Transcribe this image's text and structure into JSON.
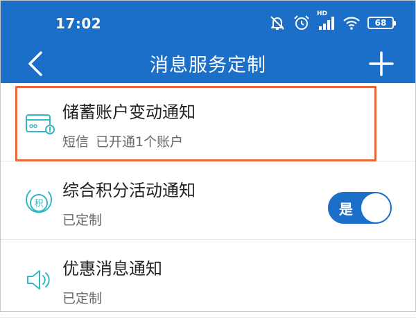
{
  "status_bar": {
    "time": "17:02",
    "network_label": "HD",
    "battery": "68",
    "icons": [
      "mute-bell-icon",
      "alarm-icon",
      "signal-icon",
      "wifi-icon",
      "battery-icon"
    ]
  },
  "header": {
    "title": "消息服务定制",
    "back_icon": "chevron-left-icon",
    "add_icon": "plus-icon"
  },
  "list": {
    "items": [
      {
        "name": "储蓄账户变动通知",
        "sub": [
          "短信",
          "已开通1个账户"
        ],
        "icon": "card-icon"
      },
      {
        "name": "综合积分活动通知",
        "sub": [
          "已定制"
        ],
        "icon": "points-icon",
        "toggle_label": "是",
        "toggle_on": true
      },
      {
        "name": "优惠消息通知",
        "sub": [
          "已定制"
        ],
        "icon": "speaker-icon"
      }
    ]
  },
  "colors": {
    "brand_blue": "#1b6fc8",
    "highlight_orange": "#e8663a",
    "icon_teal": "#35b6c4"
  }
}
